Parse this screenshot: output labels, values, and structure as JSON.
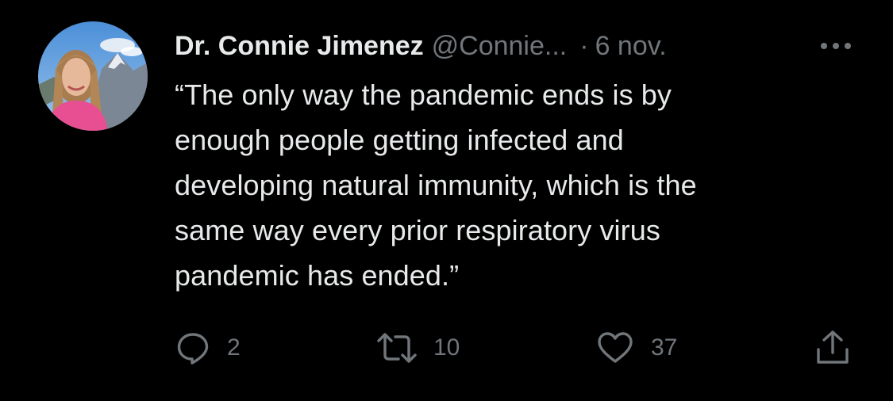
{
  "author": {
    "display_name": "Dr. Connie Jimenez",
    "handle": "@Connie...",
    "separator": "·",
    "timestamp": "6 nov."
  },
  "tweet": {
    "text": "“The only way the pandemic ends is by\nenough people getting infected and\ndeveloping natural immunity, which is the\nsame way every prior respiratory virus\npandemic has ended.”"
  },
  "actions": {
    "reply": {
      "icon": "reply-icon",
      "count": "2"
    },
    "retweet": {
      "icon": "retweet-icon",
      "count": "10"
    },
    "like": {
      "icon": "heart-icon",
      "count": "37"
    },
    "share": {
      "icon": "share-icon"
    }
  },
  "icons": {
    "more": "more-options-icon"
  },
  "colors": {
    "background": "#000000",
    "primary_text": "#e7e9ea",
    "secondary_text": "#71767b"
  }
}
